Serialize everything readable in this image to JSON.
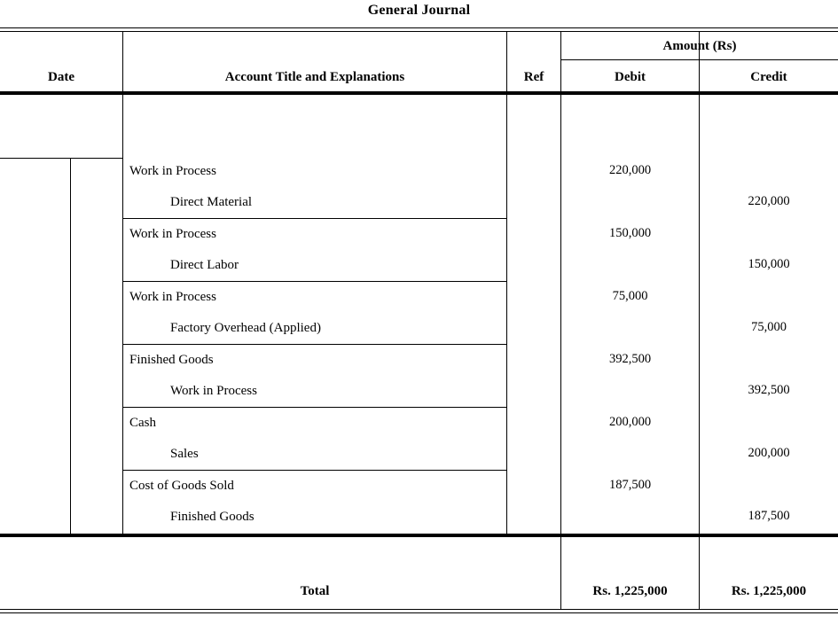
{
  "document": {
    "title": "General Journal"
  },
  "table": {
    "headers": {
      "date": "Date",
      "account": "Account Title and Explanations",
      "ref": "Ref",
      "amount_group": "Amount (Rs)",
      "debit": "Debit",
      "credit": "Credit"
    },
    "entries": [
      {
        "debit_account": "Work in Process",
        "credit_account": "Direct Material",
        "date": "",
        "ref": "",
        "debit": "220,000",
        "credit": "220,000"
      },
      {
        "debit_account": "Work in Process",
        "credit_account": "Direct Labor",
        "date": "",
        "ref": "",
        "debit": "150,000",
        "credit": "150,000"
      },
      {
        "debit_account": "Work in Process",
        "credit_account": "Factory Overhead (Applied)",
        "date": "",
        "ref": "",
        "debit": "75,000",
        "credit": "75,000"
      },
      {
        "debit_account": "Finished Goods",
        "credit_account": "Work in Process",
        "date": "",
        "ref": "",
        "debit": "392,500",
        "credit": "392,500"
      },
      {
        "debit_account": "Cash",
        "credit_account": "Sales",
        "date": "",
        "ref": "",
        "debit": "200,000",
        "credit": "200,000"
      },
      {
        "debit_account": "Cost of Goods Sold",
        "credit_account": "Finished Goods",
        "date": "",
        "ref": "",
        "debit": "187,500",
        "credit": "187,500"
      }
    ],
    "total": {
      "label": "Total",
      "debit": "Rs. 1,225,000",
      "credit": "Rs. 1,225,000"
    }
  }
}
